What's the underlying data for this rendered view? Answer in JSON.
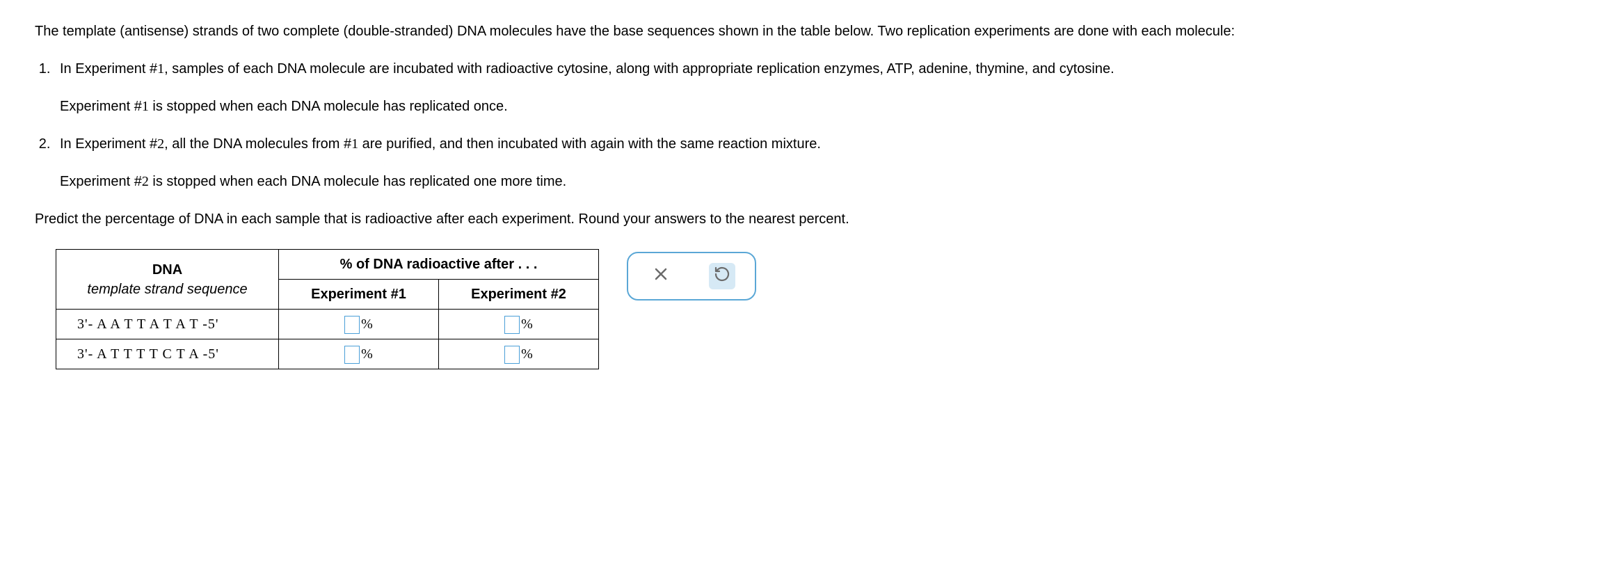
{
  "intro": "The template (antisense) strands of two complete (double-stranded) DNA molecules have the base sequences shown in the table below. Two replication experiments are done with each molecule:",
  "list": {
    "item1_main_pre": "In Experiment #",
    "item1_num1": "1",
    "item1_main_post": ", samples of each DNA molecule are incubated with radioactive cytosine, along with appropriate replication enzymes, ATP, adenine, thymine, and cytosine.",
    "item1_sub_pre": "Experiment #",
    "item1_sub_num": "1",
    "item1_sub_post": " is stopped when each DNA molecule has replicated once.",
    "item2_main_pre": "In Experiment #",
    "item2_num2a": "2",
    "item2_main_mid": ", all the DNA molecules from #",
    "item2_num2b": "1",
    "item2_main_post": " are purified, and then incubated with again with the same reaction mixture.",
    "item2_sub_pre": "Experiment #",
    "item2_sub_num": "2",
    "item2_sub_post": " is stopped when each DNA molecule has replicated one more time."
  },
  "predict": "Predict the percentage of DNA in each sample that is radioactive after each experiment. Round your answers to the nearest percent.",
  "table": {
    "dna_header": "DNA",
    "dna_subheader": "template strand sequence",
    "radio_header": "% of DNA radioactive after . . .",
    "exp1_header": "Experiment #1",
    "exp2_header": "Experiment #2",
    "seq1_pre": "3'- ",
    "seq1_main": "A A T T A T A T",
    "seq1_post": " -5'",
    "seq2_pre": "3'- ",
    "seq2_main": "A T T T T C T A",
    "seq2_post": " -5'",
    "percent_sign": "%"
  }
}
